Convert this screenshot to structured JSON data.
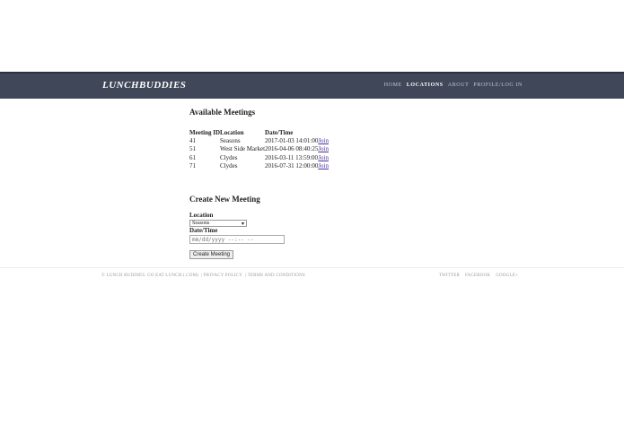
{
  "header": {
    "brand": "LunchBuddies",
    "nav": [
      "HOME",
      "LOCATIONS",
      "ABOUT",
      "PROFILE/LOG IN"
    ],
    "active_nav": "LOCATIONS"
  },
  "meetings": {
    "title": "Available Meetings",
    "columns": [
      "Meeting ID",
      "Location",
      "Date/Time"
    ],
    "rows": [
      {
        "id": "41",
        "location": "Seasons",
        "datetime": "2017-01-03 14:01:00",
        "action": "Join"
      },
      {
        "id": "51",
        "location": "West Side Market",
        "datetime": "2016-04-06 08:40:25",
        "action": "Join"
      },
      {
        "id": "61",
        "location": "Clydes",
        "datetime": "2016-03-11 13:59:00",
        "action": "Join"
      },
      {
        "id": "71",
        "location": "Clydes",
        "datetime": "2016-07-31 12:00:00",
        "action": "Join"
      }
    ]
  },
  "create": {
    "title": "Create New Meeting",
    "location_label": "Location",
    "location_value": "Seasons",
    "datetime_label": "Date/Time",
    "datetime_placeholder": "mm/dd/yyyy --:-- --",
    "button": "Create Meeting"
  },
  "footer": {
    "copyright": "© LUNCH BUDDIES. GO EAT LUNCH (.COM)",
    "privacy": "PRIVACY POLICY",
    "terms": "TERMS AND CONDITIONS",
    "social": [
      "TWITTER",
      "FACEBOOK",
      "GOOGLE+"
    ]
  }
}
